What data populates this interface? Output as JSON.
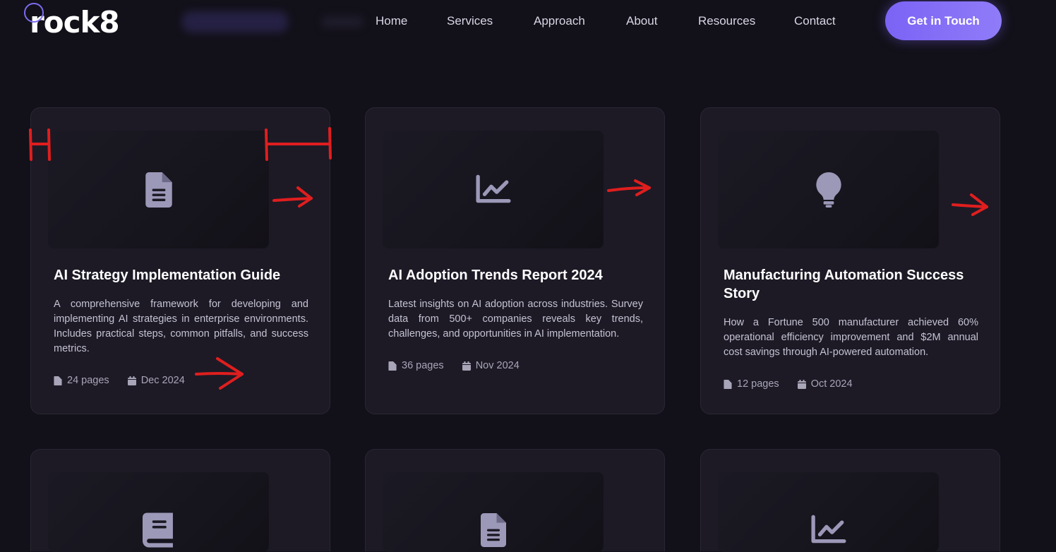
{
  "header": {
    "logo": "rock8",
    "nav": [
      "Home",
      "Services",
      "Approach",
      "About",
      "Resources",
      "Contact"
    ],
    "cta": "Get in Touch"
  },
  "cards": [
    {
      "icon": "document-icon",
      "title": "AI Strategy Implementation Guide",
      "description": "A comprehensive framework for developing and implementing AI strategies in enterprise environments. Includes practical steps, common pitfalls, and success metrics.",
      "pages": "24 pages",
      "date": "Dec 2024"
    },
    {
      "icon": "chart-line-icon",
      "title": "AI Adoption Trends Report 2024",
      "description": "Latest insights on AI adoption across industries. Survey data from 500+ companies reveals key trends, challenges, and opportunities in AI implementation.",
      "pages": "36 pages",
      "date": "Nov 2024"
    },
    {
      "icon": "lightbulb-icon",
      "title": "Manufacturing Automation Success Story",
      "description": "How a Fortune 500 manufacturer achieved 60% operational efficiency improvement and $2M annual cost savings through AI-powered automation.",
      "pages": "12 pages",
      "date": "Oct 2024"
    },
    {
      "icon": "book-icon"
    },
    {
      "icon": "document-icon"
    },
    {
      "icon": "chart-line-icon"
    }
  ],
  "colors": {
    "background": "#121018",
    "card": "#1d1a26",
    "accent": "#7b63f5",
    "icon": "#9c98b8",
    "annotation": "#e01e1e"
  }
}
